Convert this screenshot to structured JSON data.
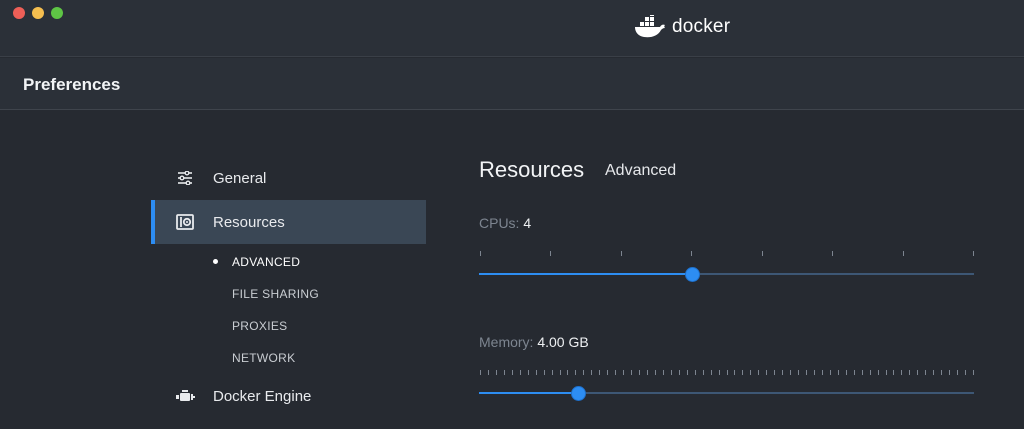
{
  "window": {
    "brand": "docker"
  },
  "header": {
    "title": "Preferences"
  },
  "sidebar": {
    "items": [
      {
        "label": "General",
        "icon": "sliders-icon"
      },
      {
        "label": "Resources",
        "icon": "resources-icon",
        "active": true
      },
      {
        "label": "Docker Engine",
        "icon": "engine-icon"
      }
    ],
    "subitems": [
      {
        "label": "ADVANCED",
        "current": true
      },
      {
        "label": "FILE SHARING"
      },
      {
        "label": "PROXIES"
      },
      {
        "label": "NETWORK"
      }
    ]
  },
  "main": {
    "heading": "Resources",
    "subheading": "Advanced",
    "cpus": {
      "label": "CPUs:",
      "value": "4",
      "level": 0.43,
      "ticks": 8
    },
    "memory": {
      "label": "Memory:",
      "value": "4.00 GB",
      "level": 0.2,
      "ticks": 63
    }
  },
  "colors": {
    "accent": "#2d8df2",
    "background": "#262a31",
    "active_item": "#3a4755"
  }
}
